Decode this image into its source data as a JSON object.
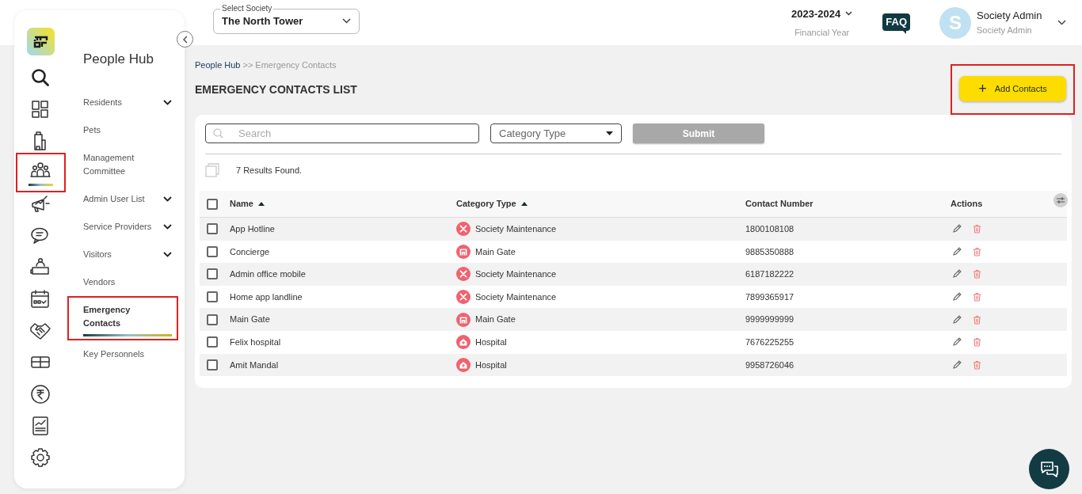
{
  "nav_rail": {
    "items": [
      {
        "kind": "search",
        "selected": false,
        "highlighted": false
      },
      {
        "kind": "dashboard",
        "selected": false,
        "highlighted": false
      },
      {
        "kind": "building",
        "selected": false,
        "highlighted": false
      },
      {
        "kind": "people",
        "selected": true,
        "highlighted": true
      },
      {
        "kind": "megaphone",
        "selected": false,
        "highlighted": false
      },
      {
        "kind": "chat",
        "selected": false,
        "highlighted": false
      },
      {
        "kind": "reception",
        "selected": false,
        "highlighted": false
      },
      {
        "kind": "calendar",
        "selected": false,
        "highlighted": false
      },
      {
        "kind": "handshake",
        "selected": false,
        "highlighted": false
      },
      {
        "kind": "box",
        "selected": false,
        "highlighted": false
      },
      {
        "kind": "rupee",
        "selected": false,
        "highlighted": false
      },
      {
        "kind": "report",
        "selected": false,
        "highlighted": false
      },
      {
        "kind": "settings",
        "selected": false,
        "highlighted": false
      }
    ]
  },
  "sidebar": {
    "title": "People Hub",
    "items": [
      {
        "label": "Residents",
        "expandable": true,
        "selected": false,
        "highlighted": false
      },
      {
        "label": "Pets",
        "expandable": false,
        "selected": false,
        "highlighted": false
      },
      {
        "label": "Management Committee",
        "expandable": false,
        "selected": false,
        "highlighted": false
      },
      {
        "label": "Admin User List",
        "expandable": true,
        "selected": false,
        "highlighted": false
      },
      {
        "label": "Service Providers",
        "expandable": true,
        "selected": false,
        "highlighted": false
      },
      {
        "label": "Visitors",
        "expandable": true,
        "selected": false,
        "highlighted": false
      },
      {
        "label": "Vendors",
        "expandable": false,
        "selected": false,
        "highlighted": false
      },
      {
        "label": "Emergency Contacts",
        "expandable": false,
        "selected": true,
        "highlighted": true
      },
      {
        "label": "Key Personnels",
        "expandable": false,
        "selected": false,
        "highlighted": false
      }
    ]
  },
  "header": {
    "society_select": {
      "label": "Select Society",
      "value": "The North Tower"
    },
    "year": {
      "value": "2023-2024",
      "caption": "Financial Year"
    },
    "faq": "FAQ",
    "user": {
      "initial": "S",
      "name": "Society Admin",
      "role": "Society Admin"
    }
  },
  "breadcrumb": {
    "link": "People Hub",
    "separator": ">>",
    "current": "Emergency Contacts"
  },
  "page_title": "EMERGENCY CONTACTS LIST",
  "add_button": {
    "label": "Add Contacts",
    "icon": "+",
    "highlighted": true
  },
  "filters": {
    "search": {
      "placeholder": "Search"
    },
    "category": {
      "placeholder": "Category Type"
    },
    "submit": "Submit"
  },
  "results": "7 Results Found.",
  "table": {
    "select_all_checked": false,
    "columns": [
      {
        "label": "Name",
        "sorted": true
      },
      {
        "label": "Category Type",
        "sorted": true
      },
      {
        "label": "Contact Number",
        "sorted": false
      },
      {
        "label": "Actions",
        "sorted": false
      }
    ],
    "rows": [
      {
        "checked": false,
        "name": "App Hotline",
        "category": {
          "kind": "maintenance",
          "label": "Society Maintenance"
        },
        "contact": "1800108108"
      },
      {
        "checked": false,
        "name": "Concierge",
        "category": {
          "kind": "gate",
          "label": "Main Gate"
        },
        "contact": "9885350888"
      },
      {
        "checked": false,
        "name": "Admin office mobile",
        "category": {
          "kind": "maintenance",
          "label": "Society Maintenance"
        },
        "contact": "6187182222"
      },
      {
        "checked": false,
        "name": "Home app landline",
        "category": {
          "kind": "maintenance",
          "label": "Society Maintenance"
        },
        "contact": "7899365917"
      },
      {
        "checked": false,
        "name": "Main Gate",
        "category": {
          "kind": "gate",
          "label": "Main Gate"
        },
        "contact": "9999999999"
      },
      {
        "checked": false,
        "name": "Felix hospital",
        "category": {
          "kind": "hospital",
          "label": "Hospital"
        },
        "contact": "7676225255"
      },
      {
        "checked": false,
        "name": "Amit Mandal",
        "category": {
          "kind": "hospital",
          "label": "Hospital"
        },
        "contact": "9958726046"
      }
    ]
  }
}
